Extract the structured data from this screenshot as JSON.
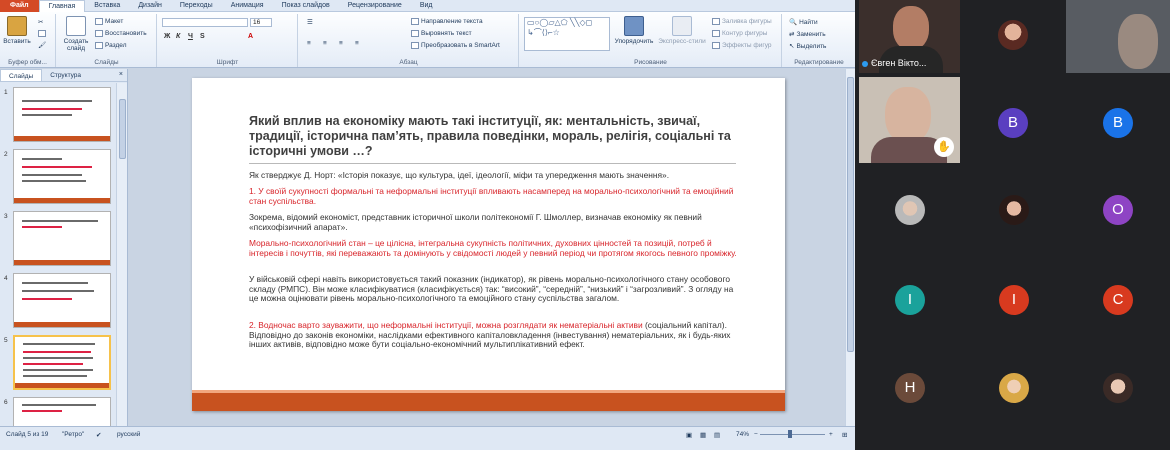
{
  "ribbon": {
    "tabs": [
      "Файл",
      "Главная",
      "Вставка",
      "Дизайн",
      "Переходы",
      "Анимация",
      "Показ слайдов",
      "Рецензирование",
      "Вид"
    ],
    "clipboard": {
      "paste": "Вставить",
      "label": "Буфер обм..."
    },
    "slides": {
      "create": "Создать слайд",
      "layout": "Макет",
      "reset": "Восстановить",
      "section": "Раздел",
      "label": "Слайды"
    },
    "font": {
      "label": "Шрифт",
      "size": "16"
    },
    "paragraph": {
      "label": "Абзац",
      "direction": "Направление текста",
      "align": "Выровнять текст",
      "smartart": "Преобразовать в SmartArt"
    },
    "drawing": {
      "arrange": "Упорядочить",
      "styles": "Экспресс-стили",
      "fill": "Заливка фигуры",
      "outline": "Контур фигуры",
      "effects": "Эффекты фигур",
      "label": "Рисование"
    },
    "editing": {
      "find": "Найти",
      "replace": "Заменить",
      "select": "Выделить",
      "label": "Редактирование"
    }
  },
  "panel": {
    "tab_slides": "Слайды",
    "tab_outline": "Структура",
    "close": "×",
    "slide_numbers": [
      "1",
      "2",
      "3",
      "4",
      "5",
      "6"
    ]
  },
  "slide": {
    "title": "Який вплив на економіку мають такі інституції, як: ментальність, звичаї, традиції, історична пам’ять, правила поведінки, мораль, релігія, соціальні та історичні умови …?",
    "p1": "Як стверджує Д. Норт: «Історія показує, що культура, ідеї, ідеології, міфи та упередження мають значення».",
    "p2": "1. У своїй сукупності формальні та неформальні інституції впливають насамперед на морально-психологічний та емоційний стан суспільства.",
    "p3": "Зокрема, відомий економіст, представник історичної школи політекономії Г. Шмоллер, визначав економіку як певний «психофізичний апарат».",
    "p4": "Морально-психологічний стан – це цілісна, інтегральна сукупність політичних, духовних цінностей та позицій, потреб й інтересів і почуттів, які переважають та домінують у свідомості людей у певний період чи протягом якогось певного проміжку.",
    "p5": "У військовій сфері навіть використовується такий показник (індикатор), як рівень морально-психологічного стану особового складу (РМПС). Він може класифікуватися (класифікується) так: “високий”, “середній”, “низький” і “загрозливий”. З огляду на це можна оцінювати рівень морально-психологічного та емоційного стану суспільства загалом.",
    "p6_a": "2. Водночас варто зауважити, що ",
    "p6_b": "неформальні інституції, можна розглядати як нематеріальні активи",
    "p6_c": " (соціальний капітал). Відповідно до законів економіки, наслідками ефективного капіталовкладення (інвестування) нематеріальних, як і будь-яких інших активів, відповідно може бути соціально-економічний мультиплікативний ефект."
  },
  "status": {
    "slide": "Слайд 5 из 19",
    "theme": "\"Ретро\"",
    "language": "русский",
    "zoom": "74%"
  },
  "meeting": {
    "tiles": [
      {
        "label": "Євген Вікто...",
        "kind": "camera"
      },
      {
        "letter": "B",
        "color": "#5a3fc0"
      },
      {
        "letter": "B",
        "color": "#1a73e8"
      },
      {
        "letter": "O",
        "color": "#8e44c4"
      },
      {
        "letter": "I",
        "color": "#1aa29b"
      },
      {
        "letter": "I",
        "color": "#d83a1f"
      },
      {
        "letter": "C",
        "color": "#d83a1f"
      },
      {
        "letter": "H",
        "color": "#6b4a3a"
      }
    ]
  }
}
